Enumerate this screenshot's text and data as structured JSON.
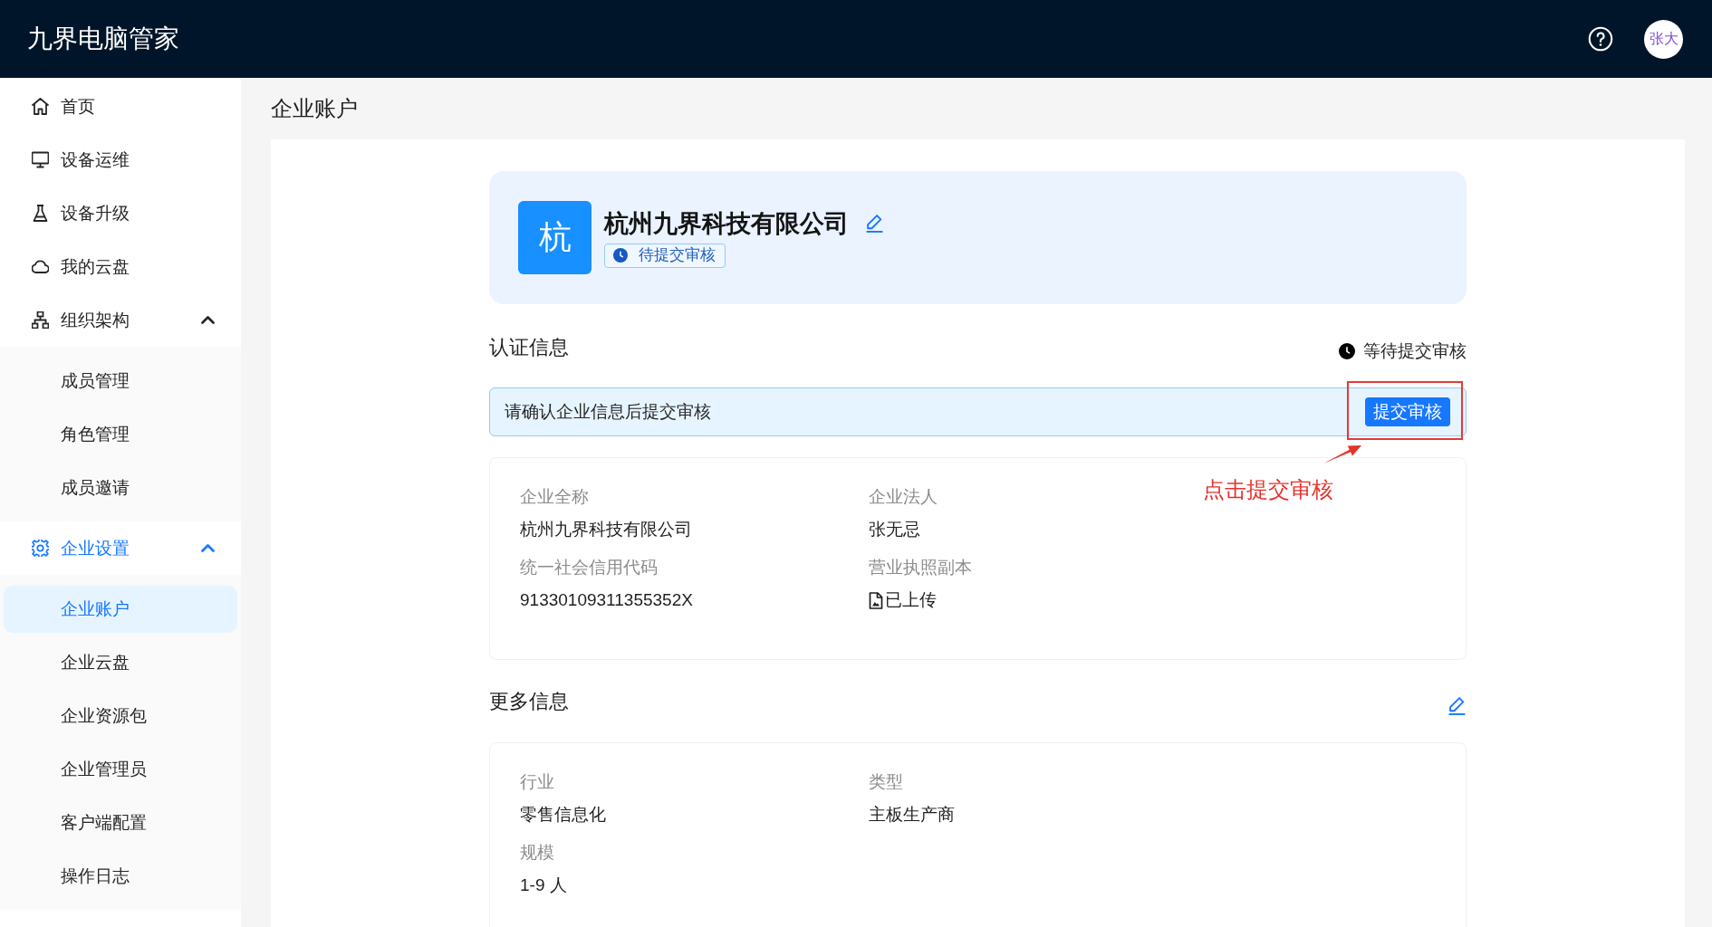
{
  "header": {
    "title": "九界电脑管家",
    "avatar": "张大"
  },
  "sidebar": {
    "items": [
      {
        "label": "首页",
        "selected": false
      },
      {
        "label": "设备运维",
        "selected": false
      },
      {
        "label": "设备升级",
        "selected": false
      },
      {
        "label": "我的云盘",
        "selected": false
      },
      {
        "label": "组织架构",
        "expanded": true,
        "children": [
          {
            "label": "成员管理",
            "selected": false
          },
          {
            "label": "角色管理",
            "selected": false
          },
          {
            "label": "成员邀请",
            "selected": false
          }
        ]
      },
      {
        "label": "企业设置",
        "expanded": true,
        "children": [
          {
            "label": "企业账户",
            "selected": true
          },
          {
            "label": "企业云盘",
            "selected": false
          },
          {
            "label": "企业资源包",
            "selected": false
          },
          {
            "label": "企业管理员",
            "selected": false
          },
          {
            "label": "客户端配置",
            "selected": false
          },
          {
            "label": "操作日志",
            "selected": false
          }
        ]
      }
    ]
  },
  "page_title": "企业账户",
  "company": {
    "avatar": "杭",
    "name": "杭州九界科技有限公司",
    "status": "待提交审核"
  },
  "certification": {
    "title": "认证信息",
    "status": "等待提交审核",
    "notice": "请确认企业信息后提交审核",
    "submit_button": "提交审核",
    "fields": [
      {
        "label": "企业全称",
        "value": "杭州九界科技有限公司",
        "kind": "text"
      },
      {
        "label": "企业法人",
        "value": "张无忌",
        "kind": "text"
      },
      {
        "label": "统一社会信用代码",
        "value": "91330109311355352X",
        "kind": "text"
      },
      {
        "label": "营业执照副本",
        "value": "已上传",
        "kind": "file"
      }
    ]
  },
  "annotation": {
    "text": "点击提交审核"
  },
  "more_info": {
    "title": "更多信息",
    "fields": [
      {
        "label": "行业",
        "value": "零售信息化",
        "kind": "text"
      },
      {
        "label": "类型",
        "value": "主板生产商",
        "kind": "text"
      },
      {
        "label": "规模",
        "value": "1-9 人",
        "kind": "text"
      }
    ]
  }
}
